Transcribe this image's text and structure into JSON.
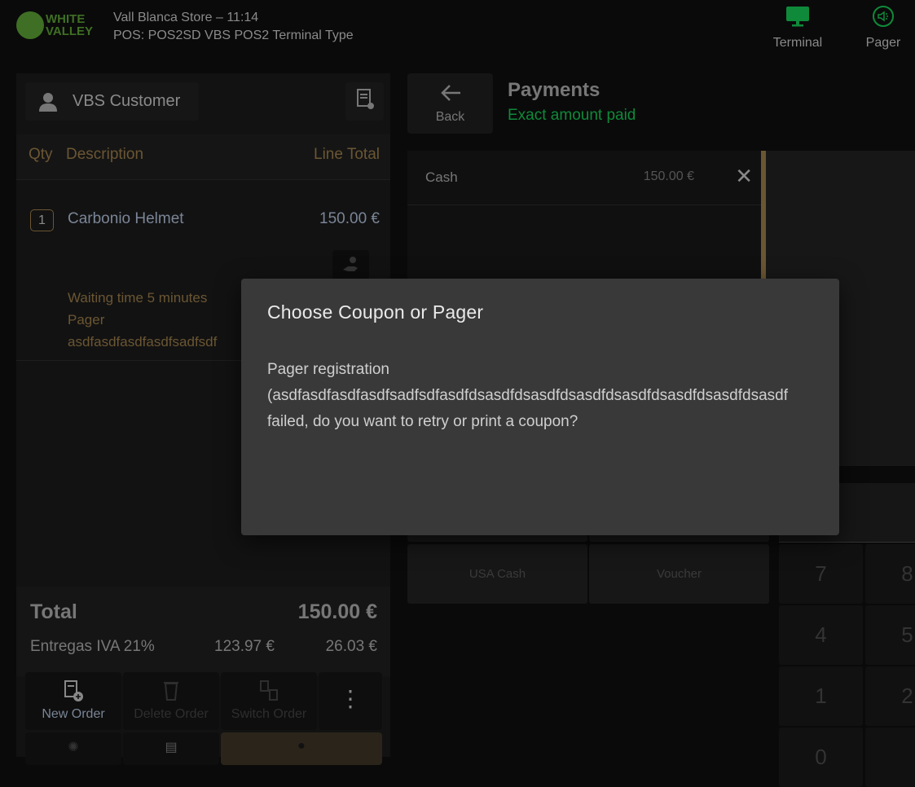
{
  "header": {
    "logo_text": "WHITE VALLEY",
    "store_line": "Vall Blanca Store – 11:14",
    "pos_line": "POS: POS2SD VBS POS2 Terminal Type",
    "terminal_label": "Terminal",
    "pager_label": "Pager",
    "accent": "#0f8a3a"
  },
  "order": {
    "customer": "VBS Customer",
    "columns": {
      "qty": "Qty",
      "description": "Description",
      "line_total": "Line Total"
    },
    "lines": [
      {
        "qty": "1",
        "description": "Carbonio Helmet",
        "total": "150.00 €",
        "notes": [
          "Waiting time 5 minutes",
          "Pager",
          "asdfasdfasdfasdfsadfsdf"
        ]
      }
    ],
    "total_label": "Total",
    "total": "150.00 €",
    "tax": {
      "label": "Entregas IVA 21%",
      "base": "123.97 €",
      "amount": "26.03 €"
    },
    "actions": {
      "new_order": "New Order",
      "delete_order": "Delete Order",
      "switch_order": "Switch Order"
    }
  },
  "payments": {
    "back": "Back",
    "title": "Payments",
    "status": "Exact amount paid",
    "status_color": "#0f8a3a",
    "entries": [
      {
        "method": "Cash",
        "amount": "150.00 €"
      }
    ],
    "methods": [
      "USA Cash",
      "Voucher"
    ],
    "keypad": [
      "7",
      "8",
      "4",
      "5",
      "1",
      "2",
      "0"
    ]
  },
  "dialog": {
    "title": "Choose Coupon or Pager",
    "line1": "Pager registration",
    "line2": "(asdfasdfasdfasdfsadfsdfasdfdsasdfdsasdfdsasdfdsasdfdsasdfdsasdfdsasdf",
    "line3": "failed, do you want to retry or print a coupon?"
  }
}
